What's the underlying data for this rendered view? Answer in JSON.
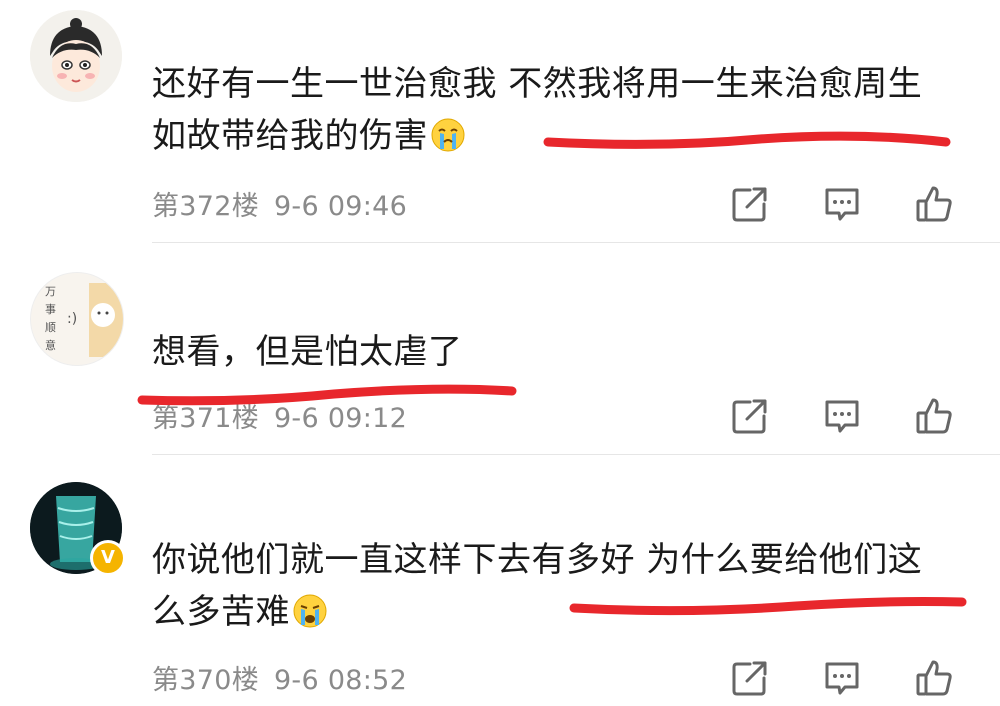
{
  "comments": [
    {
      "text_line1": "还好有一生一世治愈我 不然我将用一生来治愈周生",
      "text_line2": "如故带给我的伤害",
      "emoji": "crying-face",
      "floor": "第372楼",
      "time": "9-6 09:46"
    },
    {
      "text_line1": "想看，但是怕太虐了",
      "floor": "第371楼",
      "time": "9-6 09:12",
      "avatar_text": [
        "万",
        "事",
        "顺",
        "意"
      ],
      "avatar_face": ":)"
    },
    {
      "text_line1": "你说他们就一直这样下去有多好 为什么要给他们这",
      "text_line2": "么多苦难",
      "emoji": "loudly-crying-face",
      "floor": "第370楼",
      "time": "9-6 08:52",
      "badge": "V"
    }
  ],
  "icons": {
    "share": "share-icon",
    "reply": "comment-icon",
    "like": "thumbs-up-icon"
  },
  "colors": {
    "underline": "#e8272c",
    "meta_text": "#8a8a8a",
    "badge": "#f5b400"
  }
}
